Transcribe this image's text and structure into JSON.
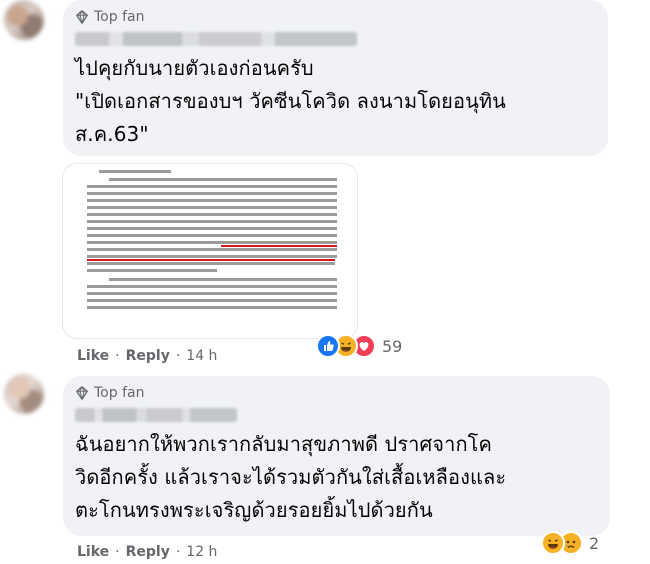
{
  "comments": [
    {
      "badge": "Top fan",
      "text": "ไปคุยกับนายตัวเองก่อนครับ\n\"เปิดเอกสารของบฯ วัคซีนโควิด ลงนามโดยอนุทิน\nส.ค.63\"",
      "actions": {
        "like": "Like",
        "reply": "Reply",
        "time": "14 h"
      },
      "reactions": {
        "icons": [
          "like-icon",
          "haha-icon",
          "love-icon"
        ],
        "count": "59"
      }
    },
    {
      "badge": "Top fan",
      "text": "ฉันอยากให้พวกเรากลับมาสุขภาพดี ปราศจากโค\nวิดอีกครั้ง แล้วเราจะได้รวมตัวกันใส่เสื้อเหลืองและ\nตะโกนทรงพระเจริญด้วยรอยยิ้มไปด้วยกัน",
      "actions": {
        "like": "Like",
        "reply": "Reply",
        "time": "12 h"
      },
      "reactions": {
        "icons": [
          "haha-icon",
          "sad-icon"
        ],
        "count": "2"
      }
    }
  ],
  "actions_separator": "·",
  "colors": {
    "bubble": "#f0f2f5",
    "meta": "#65676b",
    "like": "#1877f2",
    "love": "#f33e58",
    "haha": "#f7b125"
  }
}
